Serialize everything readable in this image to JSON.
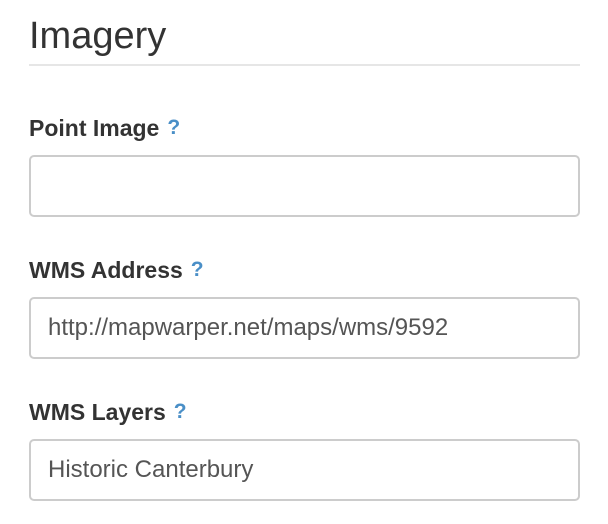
{
  "section": {
    "title": "Imagery"
  },
  "fields": {
    "point_image": {
      "label": "Point Image",
      "help": "?",
      "value": "",
      "placeholder": ""
    },
    "wms_address": {
      "label": "WMS Address",
      "help": "?",
      "value": "http://mapwarper.net/maps/wms/9592",
      "placeholder": ""
    },
    "wms_layers": {
      "label": "WMS Layers",
      "help": "?",
      "value": "Historic Canterbury",
      "placeholder": ""
    }
  },
  "colors": {
    "text": "#333333",
    "help_icon": "#4a8fc7",
    "input_border": "#cccccc",
    "divider": "#e6e6e6"
  },
  "icons": {
    "help": "question-mark-help-icon"
  }
}
